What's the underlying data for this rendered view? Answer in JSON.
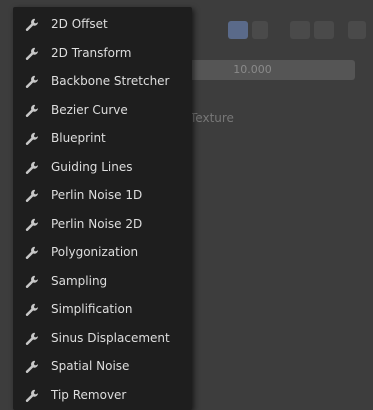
{
  "background": {
    "field_value": "10.000",
    "texture_label": "Texture"
  },
  "menu": {
    "items": [
      {
        "label": "2D Offset"
      },
      {
        "label": "2D Transform"
      },
      {
        "label": "Backbone Stretcher"
      },
      {
        "label": "Bezier Curve"
      },
      {
        "label": "Blueprint"
      },
      {
        "label": "Guiding Lines"
      },
      {
        "label": "Perlin Noise 1D"
      },
      {
        "label": "Perlin Noise 2D"
      },
      {
        "label": "Polygonization"
      },
      {
        "label": "Sampling"
      },
      {
        "label": "Simplification"
      },
      {
        "label": "Sinus Displacement"
      },
      {
        "label": "Spatial Noise"
      },
      {
        "label": "Tip Remover"
      }
    ],
    "icon": "wrench-icon"
  },
  "colors": {
    "menu_bg": "#1e1e1e",
    "text": "#dedede",
    "icon": "#c8c8c8"
  }
}
